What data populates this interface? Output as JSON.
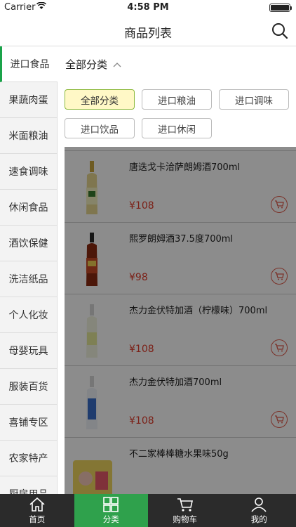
{
  "status": {
    "carrier": "Carrier",
    "time": "4:58 PM"
  },
  "header": {
    "title": "商品列表",
    "search_icon": "search-icon"
  },
  "sidebar": {
    "items": [
      {
        "label": "进口食品",
        "active": true
      },
      {
        "label": "果蔬肉蛋"
      },
      {
        "label": "米面粮油"
      },
      {
        "label": "速食调味"
      },
      {
        "label": "休闲食品"
      },
      {
        "label": "酒饮保健"
      },
      {
        "label": "洗洁纸品"
      },
      {
        "label": "个人化妆"
      },
      {
        "label": "母婴玩具"
      },
      {
        "label": "服装百货"
      },
      {
        "label": "喜铺专区"
      },
      {
        "label": "农家特产"
      },
      {
        "label": "厨房用品"
      }
    ]
  },
  "filter": {
    "label": "全部分类",
    "chips": [
      {
        "label": "全部分类",
        "selected": true
      },
      {
        "label": "进口粮油"
      },
      {
        "label": "进口调味"
      },
      {
        "label": "进口饮品"
      },
      {
        "label": "进口休闲"
      }
    ]
  },
  "products": [
    {
      "name": "唐迭戈卡洽萨朗姆酒700ml",
      "price": "¥108"
    },
    {
      "name": "熙罗朗姆酒37.5度700ml",
      "price": "¥98"
    },
    {
      "name": "杰力金伏特加酒（柠檬味）700ml",
      "price": "¥108"
    },
    {
      "name": "杰力金伏特加酒700ml",
      "price": "¥108"
    },
    {
      "name": "不二家棒棒糖水果味50g",
      "price": ""
    }
  ],
  "tabbar": {
    "items": [
      {
        "label": "首页"
      },
      {
        "label": "分类",
        "active": true
      },
      {
        "label": "购物车"
      },
      {
        "label": "我的"
      }
    ]
  },
  "colors": {
    "accent": "#2fa14c",
    "price": "#e03b2a",
    "chip_selected_bg": "#fff8c6"
  }
}
